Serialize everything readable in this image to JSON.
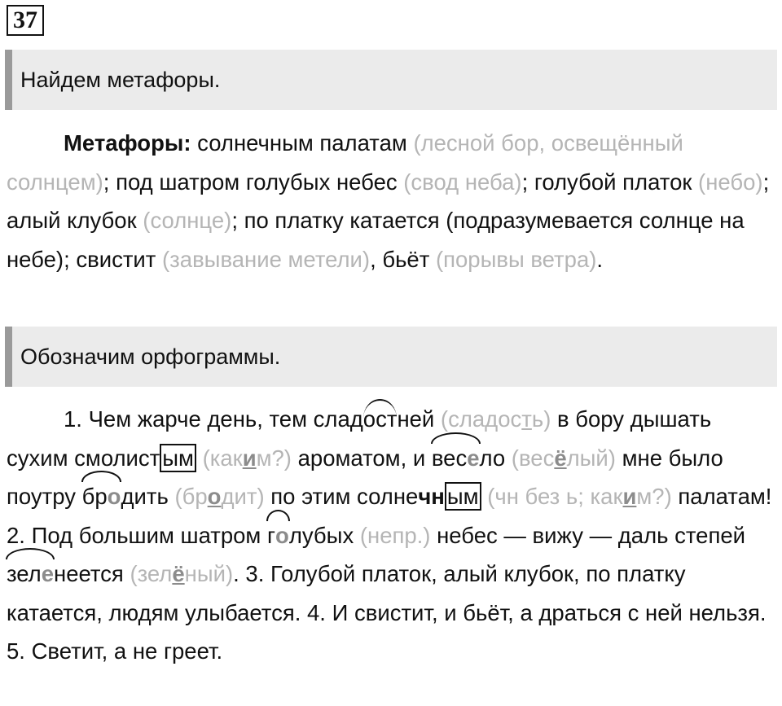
{
  "number": "37",
  "task1": {
    "heading": "Найдем метафоры.",
    "label": "Метафоры:",
    "t1": " солнечным палатам ",
    "g1": "(лесной бор, освещённый солнцем)",
    "t2": "; под шатром голубых небес ",
    "g2": "(свод неба)",
    "t3": "; голубой платок ",
    "g3": "(небо)",
    "t4": "; алый клубок ",
    "g4": "(солнце)",
    "t5": "; по платку катается (подразумевается солнце на небе); свистит ",
    "g5": "(завывание метели)",
    "t6": ", бьёт ",
    "g6": "(порывы ветра)",
    "t7": "."
  },
  "task2": {
    "heading": "Обозначим орфограммы.",
    "s1": "1. Чем жарче день, тем слад",
    "s1arc": "ост",
    "s1b": "ней ",
    "h1a": "(сладос",
    "h1b": "т",
    "h1c": "ь)",
    "s2": " в бору дышать сухим смолист",
    "s2box": "ым",
    "h2a": " (как",
    "h2b": "и",
    "h2c": "м?)",
    "s3": " ароматом, и ",
    "s3arc": "вес",
    "s3v": "е",
    "s3c": "ло",
    "h3a": " (вес",
    "h3b": "ё",
    "h3c": "лый)",
    "s4": " мне было поутру ",
    "s4arc": "бр",
    "s4v": "о",
    "s4c": "дить",
    "h4a": " (бр",
    "h4b": "о",
    "h4c": "дит)",
    "s5": " по этим солне",
    "s5b": "чн",
    "s5box": "ым",
    "h5a": " (чн без ь; как",
    "h5b": "и",
    "h5c": "м?)",
    "s6": " палатам! 2. Под большим шатром ",
    "s6arc": "г",
    "s6v": "о",
    "s6c": "лубых",
    "h6": " (непр.)",
    "s7": " небес — вижу — даль степей ",
    "s7arc": "зел",
    "s7v": "е",
    "s7c": "неется",
    "h7a": " (зел",
    "h7b": "ё",
    "h7c": "ный)",
    "s8": ". 3. Голубой платок, алый клубок, по платку катается, людям улыбается. 4. И свистит, и бьёт, а драться с ней нельзя. 5. Светит, а не греет."
  }
}
